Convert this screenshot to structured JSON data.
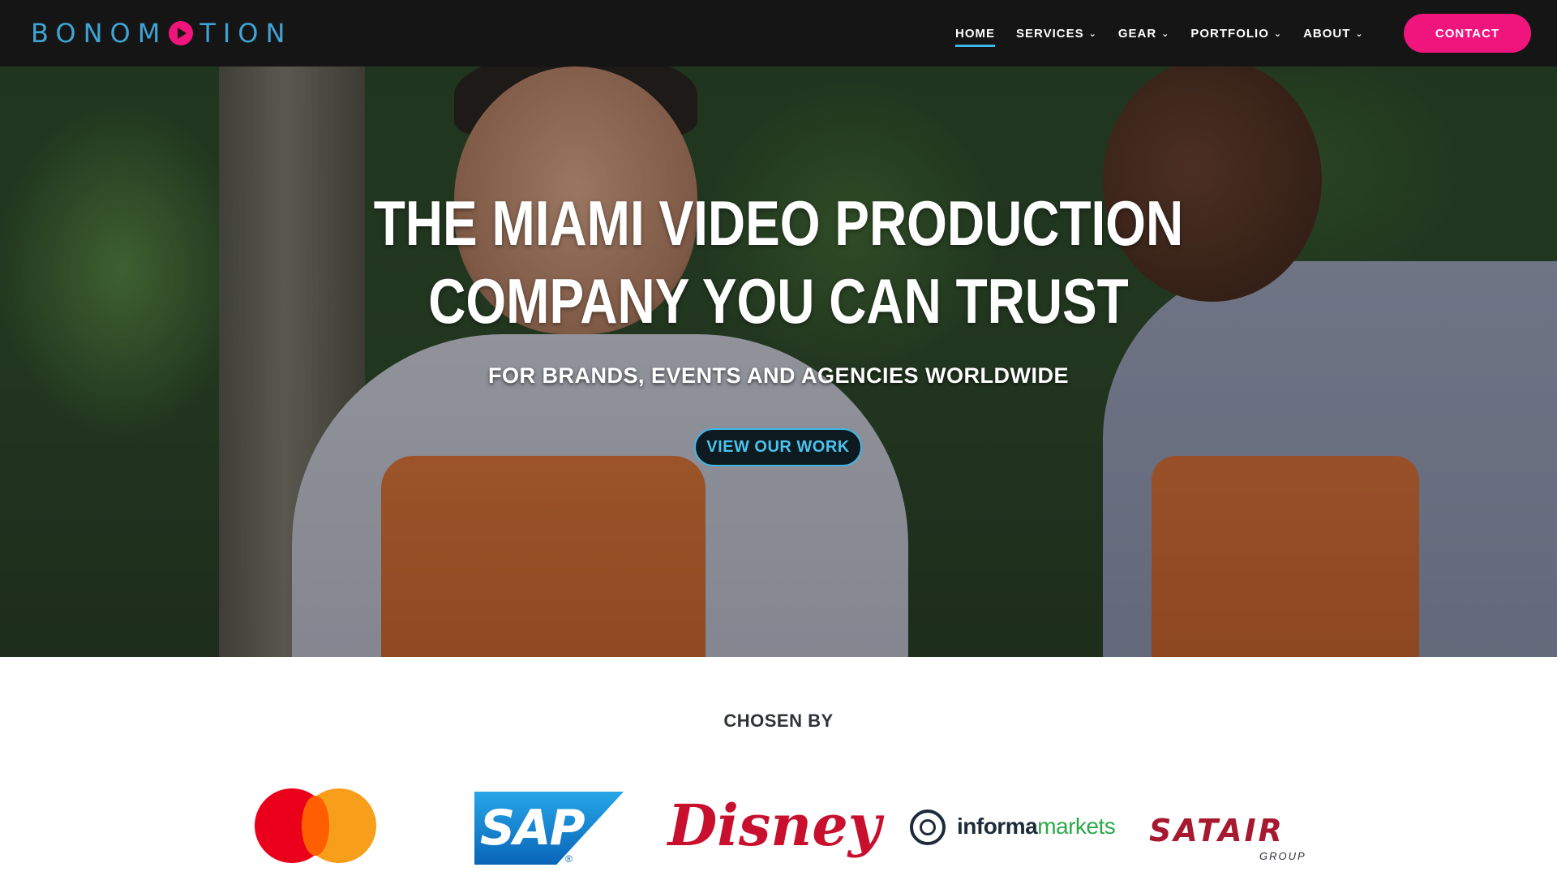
{
  "brand": {
    "logo_left": "BONO",
    "logo_right": "TION",
    "logo_m": "M"
  },
  "nav": {
    "items": [
      {
        "label": "HOME",
        "active": true,
        "has_dropdown": false
      },
      {
        "label": "SERVICES",
        "active": false,
        "has_dropdown": true
      },
      {
        "label": "GEAR",
        "active": false,
        "has_dropdown": true
      },
      {
        "label": "PORTFOLIO",
        "active": false,
        "has_dropdown": true
      },
      {
        "label": "ABOUT",
        "active": false,
        "has_dropdown": true
      }
    ],
    "chevron": "⌄",
    "contact_label": "CONTACT"
  },
  "hero": {
    "title_line1": "THE MIAMI VIDEO PRODUCTION",
    "title_line2": "COMPANY YOU CAN TRUST",
    "subtitle": "FOR BRANDS, EVENTS AND AGENCIES WORLDWIDE",
    "cta_label": "VIEW OUR WORK"
  },
  "clients": {
    "heading": "CHOSEN BY",
    "logos": [
      {
        "name": "Mastercard",
        "icon": "mastercard-logo"
      },
      {
        "name": "SAP",
        "text": "SAP",
        "reg": "®",
        "icon": "sap-logo"
      },
      {
        "name": "Disney",
        "text": "Disney",
        "icon": "disney-logo"
      },
      {
        "name": "informa markets",
        "text_a": "informa",
        "text_b": "markets",
        "icon": "informa-logo"
      },
      {
        "name": "Satair Group",
        "text": "SATAIR",
        "sub": "GROUP",
        "icon": "satair-logo"
      }
    ]
  },
  "colors": {
    "header_bg": "#151515",
    "brand_blue": "#3fa3d6",
    "brand_pink": "#f0147d",
    "cta_border": "#3fb7e6"
  }
}
